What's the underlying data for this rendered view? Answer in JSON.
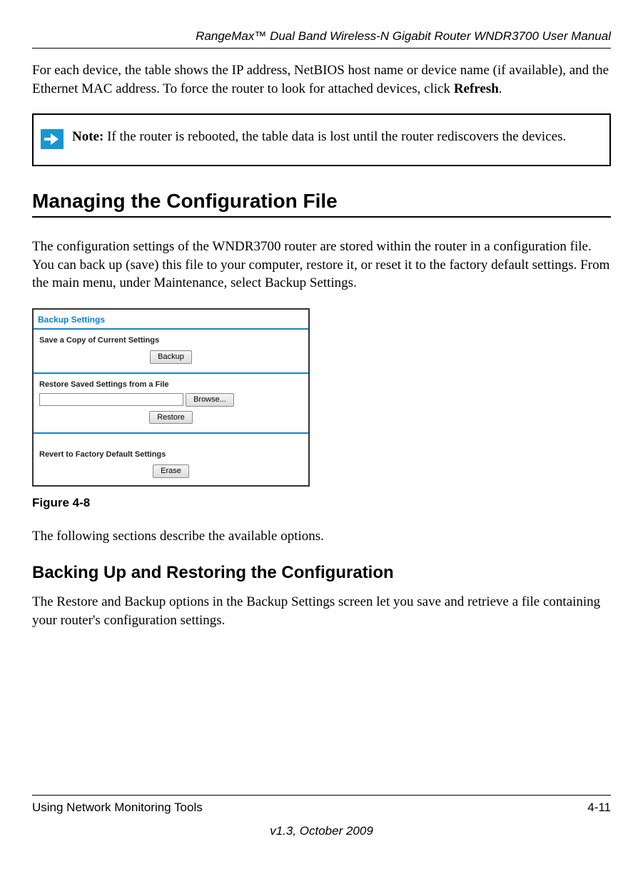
{
  "header": {
    "title": "RangeMax™ Dual Band Wireless-N Gigabit Router WNDR3700 User Manual"
  },
  "intro_para_part1": "For each device, the table shows the IP address, NetBIOS host name or device name (if available), and the Ethernet MAC address. To force the router to look for attached devices, click ",
  "intro_para_refresh": "Refresh",
  "intro_para_period": ".",
  "note": {
    "label": "Note:",
    "text": " If the router is rebooted, the table data is lost until the router rediscovers the devices."
  },
  "section_heading": "Managing the Configuration File",
  "section_para": "The configuration settings of the WNDR3700 router are stored within the router in a configuration file. You can back up (save) this file to your computer, restore it, or reset it to the factory default settings. From the main menu, under Maintenance, select Backup Settings.",
  "screenshot": {
    "title": "Backup Settings",
    "save_label": "Save a Copy of Current Settings",
    "backup_btn": "Backup",
    "restore_label": "Restore Saved Settings from a File",
    "browse_btn": "Browse...",
    "restore_btn": "Restore",
    "revert_label": "Revert to Factory Default Settings",
    "erase_btn": "Erase"
  },
  "figure_caption": "Figure 4-8",
  "following_para": "The following sections describe the available options.",
  "subsection_heading": "Backing Up and Restoring the Configuration",
  "subsection_para": "The Restore and Backup options in the Backup Settings screen let you save and retrieve a file containing your router's configuration settings.",
  "footer": {
    "left": "Using Network Monitoring Tools",
    "right": "4-11",
    "version": "v1.3, October 2009"
  }
}
